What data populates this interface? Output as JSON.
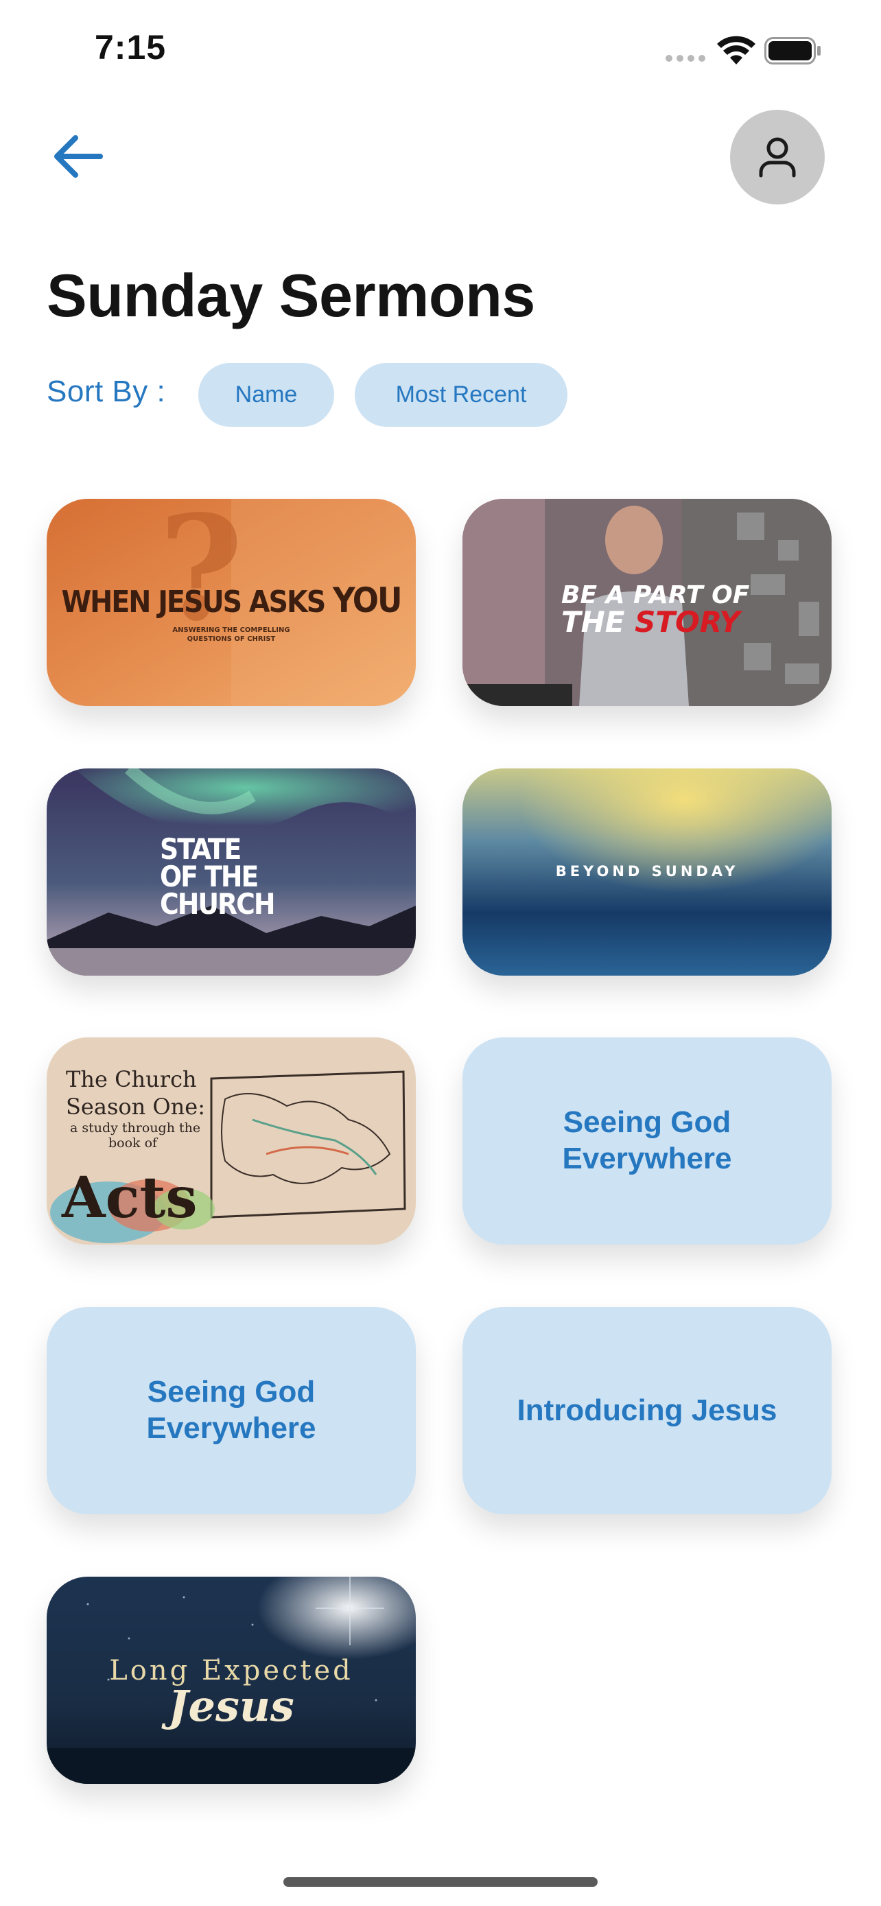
{
  "status_bar": {
    "time": "7:15"
  },
  "header": {
    "back_icon": "arrow-left-icon",
    "profile_icon": "user-icon"
  },
  "page": {
    "title": "Sunday Sermons"
  },
  "sort": {
    "label": "Sort By :",
    "options": [
      "Name",
      "Most Recent"
    ]
  },
  "colors": {
    "accent": "#2577c0",
    "chip_background": "#cde2f3"
  },
  "sermons": [
    {
      "type": "image",
      "artwork": {
        "line1": "WHEN JESUS ASKS ",
        "line1_emph": "YOU",
        "line2": "ANSWERING THE COMPELLING",
        "line3": "QUESTIONS OF CHRIST"
      }
    },
    {
      "type": "image",
      "artwork": {
        "line1": "BE A PART OF",
        "line2a": "THE ",
        "line2b": "STORY"
      }
    },
    {
      "type": "image",
      "artwork": {
        "line1": "STATE",
        "line2": "OF THE",
        "line3": "CHURCH"
      }
    },
    {
      "type": "image",
      "artwork": {
        "line1": "BEYOND SUNDAY"
      }
    },
    {
      "type": "image",
      "artwork": {
        "line1": "The Church",
        "line2": "Season One:",
        "line3": "a study through the",
        "line4": "book of",
        "line5": "Acts"
      }
    },
    {
      "type": "text",
      "title": "Seeing God Everywhere"
    },
    {
      "type": "text",
      "title": "Seeing God Everywhere"
    },
    {
      "type": "text",
      "title": "Introducing Jesus"
    },
    {
      "type": "image",
      "artwork": {
        "line1": "Long Expected",
        "line2": "Jesus"
      }
    }
  ]
}
